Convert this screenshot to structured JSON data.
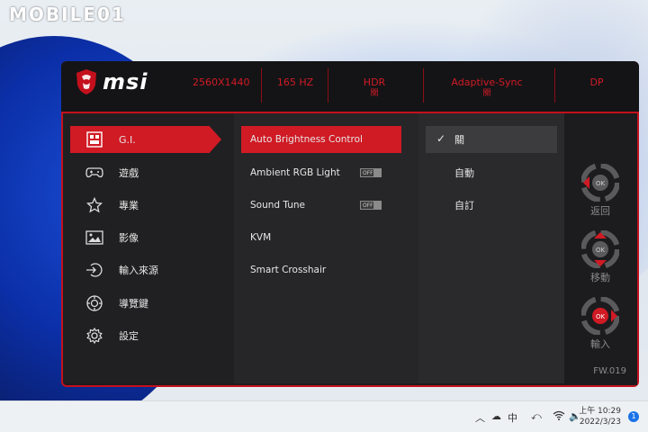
{
  "watermark": "MOBILE01",
  "brand": {
    "logo_text": "msi"
  },
  "status_bar": [
    {
      "value": "2560X1440",
      "sub": ""
    },
    {
      "value": "165 HZ",
      "sub": ""
    },
    {
      "value": "HDR",
      "sub": "關"
    },
    {
      "value": "Adaptive-Sync",
      "sub": "關"
    },
    {
      "value": "DP",
      "sub": ""
    }
  ],
  "main_menu": [
    {
      "label": "G.I.",
      "icon": "gi-icon",
      "active": true
    },
    {
      "label": "遊戲",
      "icon": "gamepad-icon",
      "active": false
    },
    {
      "label": "專業",
      "icon": "star-icon",
      "active": false
    },
    {
      "label": "影像",
      "icon": "image-icon",
      "active": false
    },
    {
      "label": "輸入來源",
      "icon": "input-source-icon",
      "active": false
    },
    {
      "label": "導覽鍵",
      "icon": "navi-key-icon",
      "active": false
    },
    {
      "label": "設定",
      "icon": "gear-icon",
      "active": false
    }
  ],
  "sub_menu": [
    {
      "label": "Auto Brightness Control",
      "active": true,
      "toggle": ""
    },
    {
      "label": "Ambient RGB Light",
      "active": false,
      "toggle": "OFF"
    },
    {
      "label": "Sound Tune",
      "active": false,
      "toggle": "OFF"
    },
    {
      "label": "KVM",
      "active": false,
      "toggle": ""
    },
    {
      "label": "Smart Crosshair",
      "active": false,
      "toggle": ""
    }
  ],
  "options": [
    {
      "label": "關",
      "selected": true
    },
    {
      "label": "自動",
      "selected": false
    },
    {
      "label": "自訂",
      "selected": false
    }
  ],
  "nav_keys": [
    {
      "key": "OK",
      "label": "返回"
    },
    {
      "key": "OK",
      "label": "移動"
    },
    {
      "key": "OK",
      "label": "輸入"
    }
  ],
  "firmware": "FW.019",
  "taskbar": {
    "ime": "中",
    "time": "上午 10:29",
    "date": "2022/3/23",
    "notification_count": "1"
  },
  "colors": {
    "accent": "#d01a24",
    "panel": "#1c1c1e"
  }
}
